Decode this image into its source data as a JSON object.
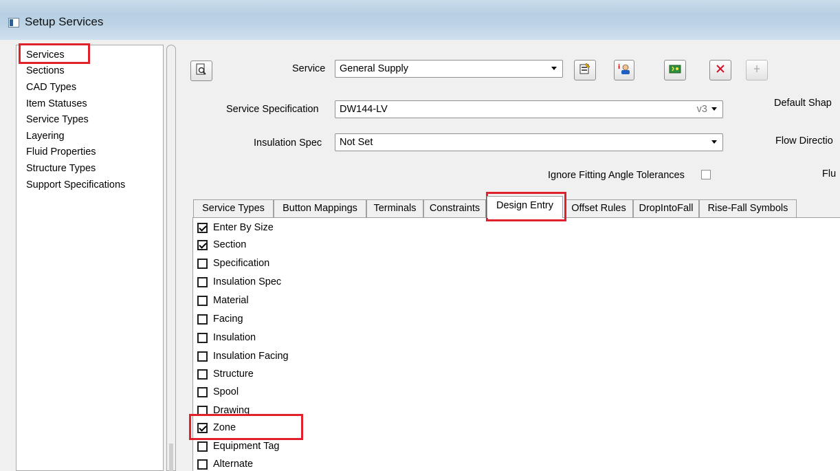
{
  "window": {
    "title": "Setup Services"
  },
  "sidebar": {
    "items": [
      {
        "label": "Services"
      },
      {
        "label": "Sections"
      },
      {
        "label": "CAD Types"
      },
      {
        "label": "Item Statuses"
      },
      {
        "label": "Service Types"
      },
      {
        "label": "Layering"
      },
      {
        "label": "Fluid Properties"
      },
      {
        "label": "Structure Types"
      },
      {
        "label": "Support Specifications"
      }
    ],
    "selected": "Services"
  },
  "form": {
    "service_label": "Service",
    "service_value": "General Supply",
    "spec_label": "Service Specification",
    "spec_value": "DW144-LV",
    "spec_version": "v3",
    "insulation_label": "Insulation Spec",
    "insulation_value": "Not Set",
    "ignore_label": "Ignore Fitting Angle Tolerances",
    "ignore_checked": false,
    "default_shape_label": "Default Shap",
    "flow_direction_label": "Flow Directio",
    "fluid_label": "Flu"
  },
  "toolbar": {
    "icons": [
      "preview-icon",
      "properties-icon",
      "user-info-icon",
      "add-icon",
      "delete-icon",
      "pin-icon"
    ]
  },
  "tabs": [
    {
      "label": "Service Types"
    },
    {
      "label": "Button Mappings"
    },
    {
      "label": "Terminals"
    },
    {
      "label": "Constraints"
    },
    {
      "label": "Design Entry",
      "active": true
    },
    {
      "label": "Offset Rules"
    },
    {
      "label": "DropIntoFall"
    },
    {
      "label": "Rise-Fall Symbols"
    }
  ],
  "design_entry": [
    {
      "label": "Enter By Size",
      "checked": true
    },
    {
      "label": "Section",
      "checked": true
    },
    {
      "label": "Specification",
      "checked": false
    },
    {
      "label": "Insulation Spec",
      "checked": false
    },
    {
      "label": "Material",
      "checked": false
    },
    {
      "label": "Facing",
      "checked": false
    },
    {
      "label": "Insulation",
      "checked": false
    },
    {
      "label": "Insulation Facing",
      "checked": false
    },
    {
      "label": "Structure",
      "checked": false
    },
    {
      "label": "Spool",
      "checked": false
    },
    {
      "label": "Drawing",
      "checked": false
    },
    {
      "label": "Zone",
      "checked": true
    },
    {
      "label": "Equipment Tag",
      "checked": false
    },
    {
      "label": "Alternate",
      "checked": false
    }
  ],
  "colors": {
    "highlight": "#e0202a"
  }
}
